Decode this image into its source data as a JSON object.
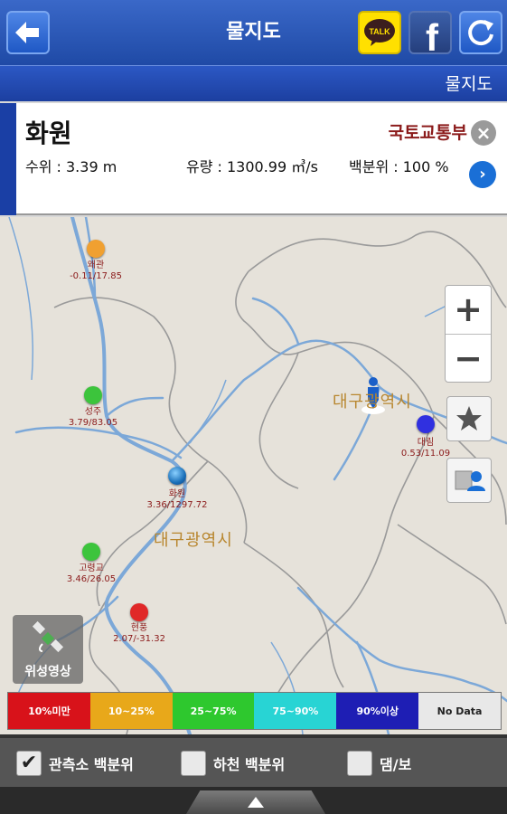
{
  "header": {
    "title": "물지도",
    "kakao_label": "TALK",
    "facebook_label": "f"
  },
  "subheader": {
    "title": "물지도"
  },
  "station": {
    "name": "화원",
    "agency": "국토교통부",
    "water_level": "수위 : 3.39 m",
    "flow": "유량 : 1300.99 ㎥/s",
    "percentile": "백분위 : 100 %"
  },
  "map": {
    "markers": [
      {
        "name": "왜관",
        "value": "-0.11/17.85",
        "color": "#f0a030"
      },
      {
        "name": "성주",
        "value": "3.79/83.05",
        "color": "#3cc43c"
      },
      {
        "name": "화원",
        "value": "3.36/1297.72",
        "color": "#1a6fb8"
      },
      {
        "name": "고령교",
        "value": "3.46/26.05",
        "color": "#3cc43c"
      },
      {
        "name": "현풍",
        "value": "2.07/-31.32",
        "color": "#e02828"
      },
      {
        "name": "대림",
        "value": "0.53/11.09",
        "color": "#3030e0"
      }
    ],
    "city_labels": [
      "대구광역시",
      "대구광역시"
    ],
    "zoom_in": "+",
    "zoom_out": "−",
    "satellite_label": "위성영상"
  },
  "legend": [
    {
      "label": "10%미만",
      "color": "#d8121a"
    },
    {
      "label": "10~25%",
      "color": "#e8a81a"
    },
    {
      "label": "25~75%",
      "color": "#2ec82e"
    },
    {
      "label": "75~90%",
      "color": "#28d4d4"
    },
    {
      "label": "90%이상",
      "color": "#1e1eb4"
    },
    {
      "label": "No Data",
      "color": "#e8e8e8"
    }
  ],
  "checkboxes": [
    {
      "label": "관측소 백분위",
      "checked": true
    },
    {
      "label": "하천 백분위",
      "checked": false
    },
    {
      "label": "댐/보",
      "checked": false
    }
  ]
}
